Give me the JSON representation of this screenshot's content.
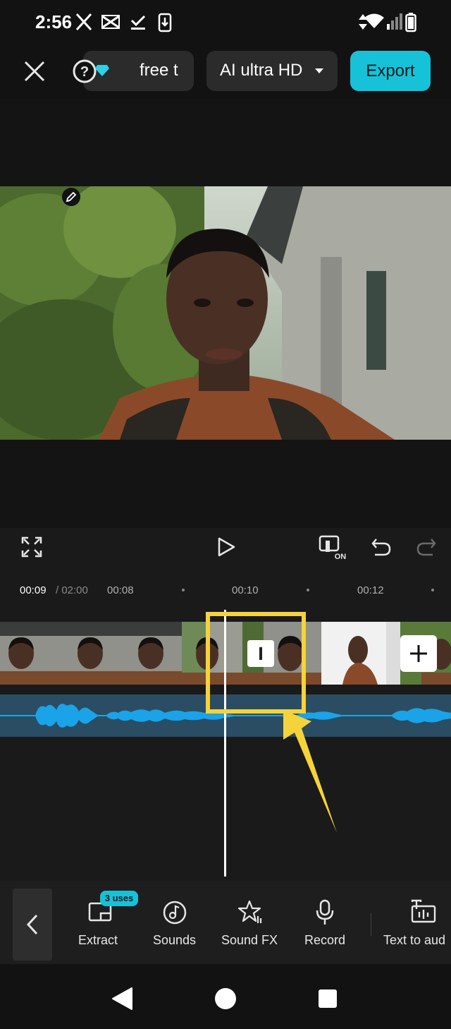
{
  "status_bar": {
    "time": "2:56",
    "icons": [
      "x-logo-icon",
      "capcut-icon",
      "check-download-icon",
      "download-icon",
      "data-arrows-icon",
      "wifi-icon",
      "signal-icon",
      "battery-icon"
    ]
  },
  "top_bar": {
    "close_icon": "close-icon",
    "help_icon": "help-icon",
    "promo_text": "free t",
    "quality_label": "AI ultra HD",
    "export_label": "Export"
  },
  "player": {
    "current_time": "00:09",
    "total_time": "/ 02:00"
  },
  "ruler": {
    "ticks": [
      "00:08",
      "00:10",
      "00:12"
    ]
  },
  "toolbar": {
    "items": [
      {
        "label": "Extract",
        "badge": "3 uses",
        "icon": "extract-icon"
      },
      {
        "label": "Sounds",
        "icon": "music-note-icon"
      },
      {
        "label": "Sound FX",
        "icon": "sound-fx-icon"
      },
      {
        "label": "Record",
        "icon": "microphone-icon"
      },
      {
        "label": "Text to aud",
        "icon": "text-to-audio-icon"
      }
    ]
  },
  "colors": {
    "accent": "#17c2d8",
    "highlight": "#f5d33a",
    "audio_wave": "#1aa3e8",
    "audio_track": "#2a4d63"
  }
}
